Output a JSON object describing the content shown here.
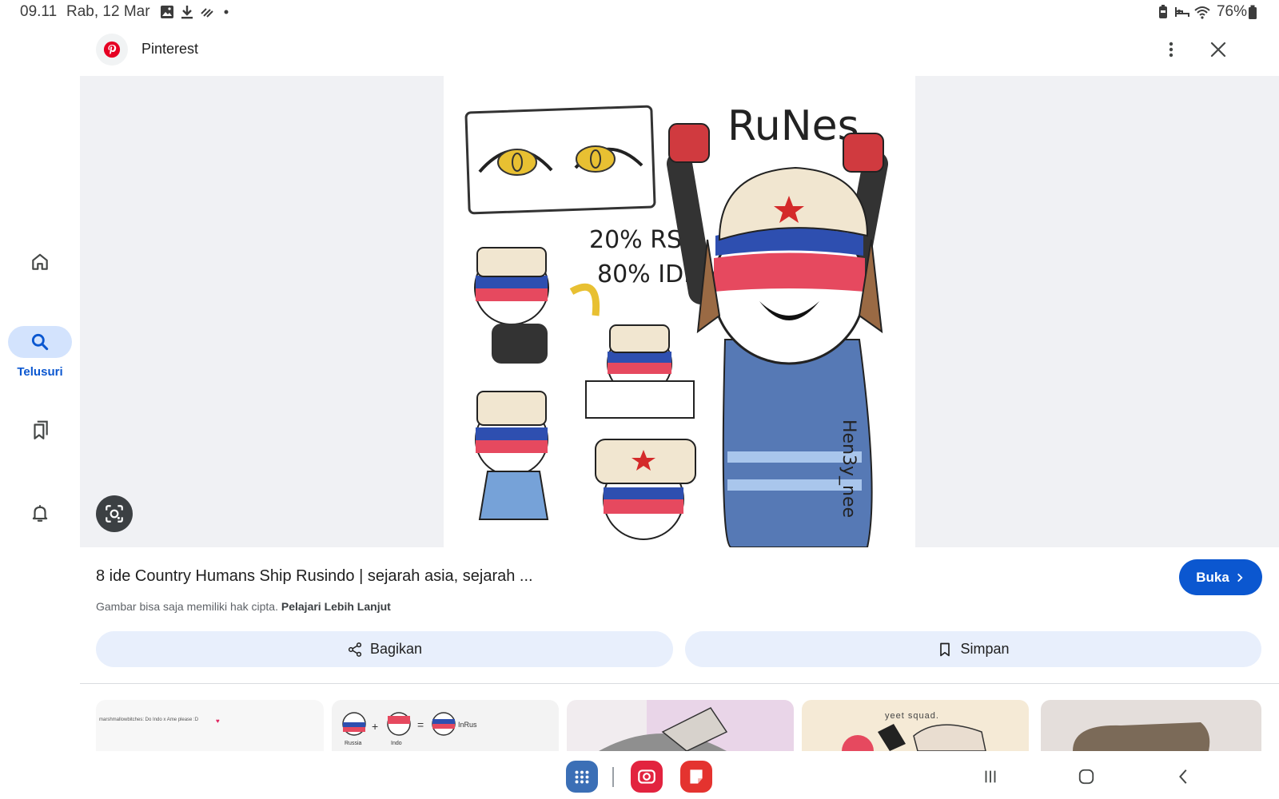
{
  "status_bar": {
    "time": "09.11",
    "date": "Rab, 12 Mar",
    "battery": "76%"
  },
  "rail": {
    "items": [
      {
        "icon": "home-icon"
      },
      {
        "icon": "search-icon",
        "label": "Telusuri",
        "active": true
      },
      {
        "icon": "collections-icon"
      },
      {
        "icon": "notifications-icon"
      }
    ],
    "active_color": "#0b57d0",
    "active_bg": "#d3e3fd"
  },
  "header": {
    "source": "Pinterest",
    "brand_color": "#e60023"
  },
  "image": {
    "artwork_texts": {
      "title": "RuNes",
      "ratio1": "20% RS",
      "ratio2": "80% IDN",
      "signature": "Hen3y_nee"
    }
  },
  "result": {
    "title": "8 ide Country Humans Ship Rusindo | sejarah asia, sejarah ...",
    "copyright_text": "Gambar bisa saja memiliki hak cipta.",
    "learn_more": "Pelajari Lebih Lanjut",
    "open_label": "Buka",
    "share_label": "Bagikan",
    "save_label": "Simpan",
    "accent": "#0b57d0",
    "pill_bg": "#e8effc"
  },
  "related": {
    "thumb1_text": "marshmallowbitches: Do Indo x Ame please :D",
    "thumb2_labels": [
      "Russia",
      "Indo",
      "InRus"
    ],
    "thumb4_text": "yeet squad."
  }
}
